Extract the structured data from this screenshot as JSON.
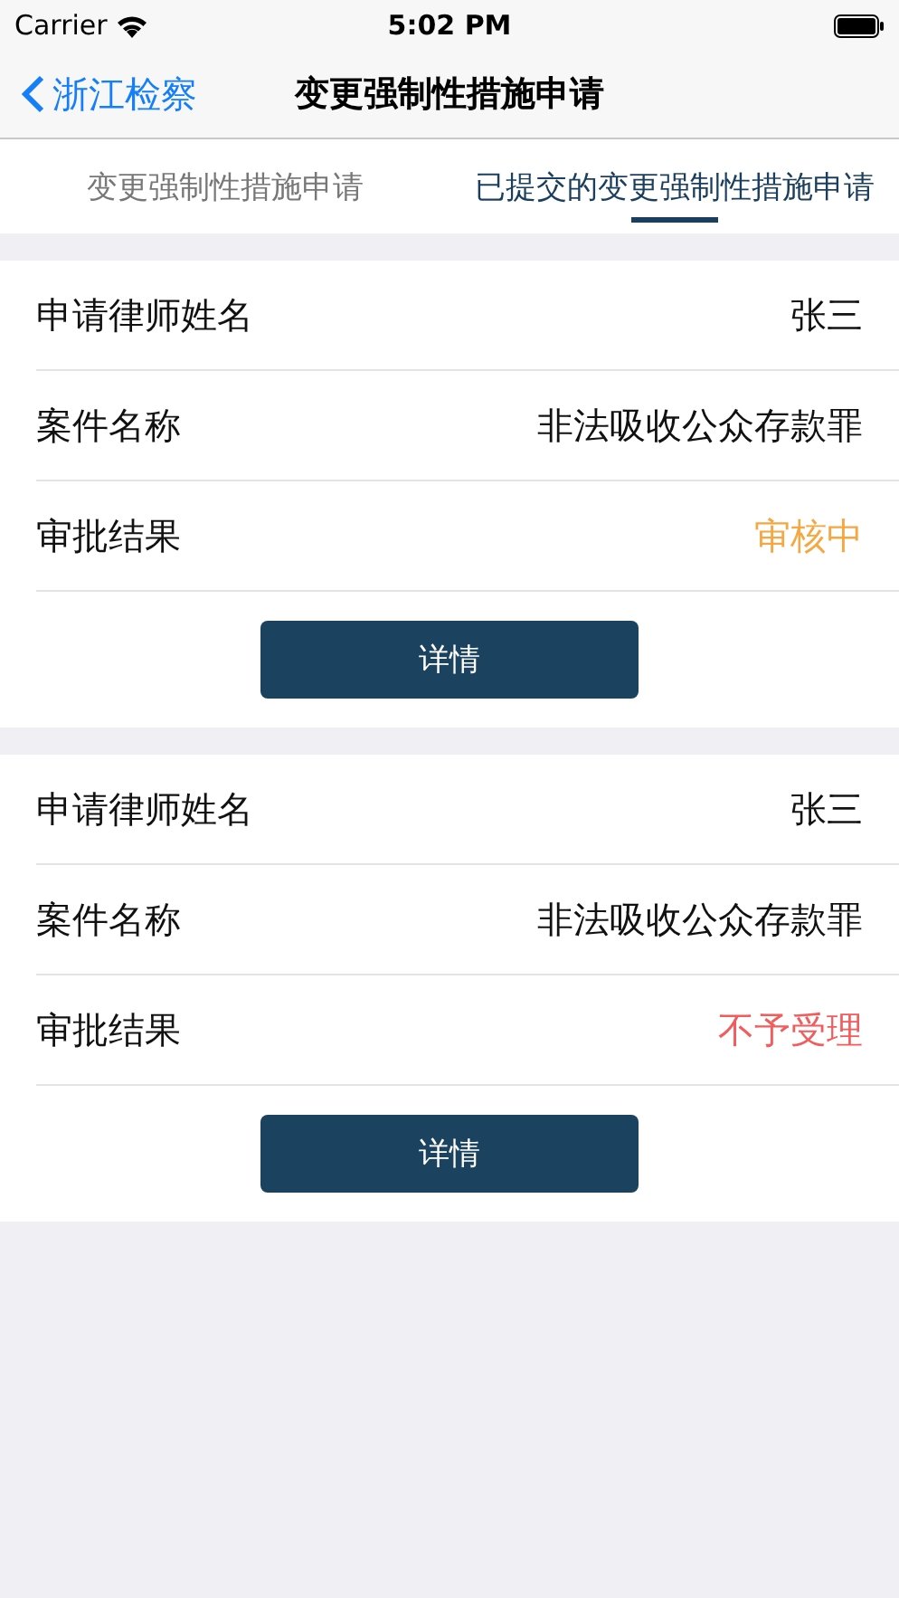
{
  "status_bar": {
    "carrier": "Carrier",
    "time": "5:02 PM"
  },
  "nav": {
    "back": "浙江检察",
    "title": "变更强制性措施申请"
  },
  "tabs": [
    {
      "label": "变更强制性措施申请",
      "selected": false
    },
    {
      "label": "已提交的变更强制性措施申请",
      "selected": true
    }
  ],
  "records": [
    {
      "rows": [
        {
          "label": "申请律师姓名",
          "value": "张三"
        },
        {
          "label": "案件名称",
          "value": "非法吸收公众存款罪"
        },
        {
          "label": "审批结果",
          "value": "审核中",
          "color": "#f5a742"
        }
      ],
      "button": "详情"
    },
    {
      "rows": [
        {
          "label": "申请律师姓名",
          "value": "张三"
        },
        {
          "label": "案件名称",
          "value": "非法吸收公众存款罪"
        },
        {
          "label": "审批结果",
          "value": "不予受理",
          "color": "#f25c5c"
        }
      ],
      "button": "详情"
    }
  ]
}
